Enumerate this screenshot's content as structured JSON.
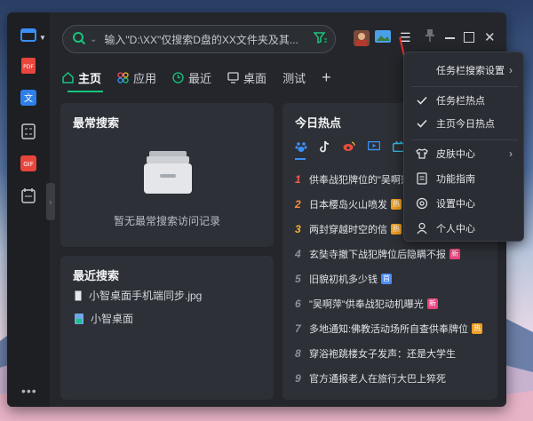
{
  "search": {
    "placeholder": "输入\"D:\\XX\"仅搜索D盘的XX文件夹及其..."
  },
  "tabs": [
    {
      "label": "主页"
    },
    {
      "label": "应用"
    },
    {
      "label": "最近"
    },
    {
      "label": "桌面"
    },
    {
      "label": "测试"
    },
    {
      "label": "+"
    }
  ],
  "frequent": {
    "title": "最常搜索",
    "empty": "暂无最常搜索访问记录"
  },
  "recent": {
    "title": "最近搜索",
    "items": [
      {
        "name": "小智桌面手机端同步.jpg"
      },
      {
        "name": "小智桌面"
      }
    ]
  },
  "hot": {
    "title": "今日热点",
    "items": [
      {
        "rank": "1",
        "text": "供奉战犯牌位的\"吴啊萍",
        "badge": ""
      },
      {
        "rank": "2",
        "text": "日本樱岛火山喷发",
        "badge": "热"
      },
      {
        "rank": "3",
        "text": "两封穿越时空的信",
        "badge": "热"
      },
      {
        "rank": "4",
        "text": "玄奘寺撤下战犯牌位后隐瞒不报",
        "badge": "新"
      },
      {
        "rank": "5",
        "text": "旧貌初机多少钱",
        "badge": "首"
      },
      {
        "rank": "6",
        "text": "\"吴啊萍\"供奉战犯动机曝光",
        "badge": "新"
      },
      {
        "rank": "7",
        "text": "多地通知:佛教活动场所自查供奉牌位",
        "badge": "热"
      },
      {
        "rank": "8",
        "text": "穿浴袍跳楼女子发声：还是大学生",
        "badge": ""
      },
      {
        "rank": "9",
        "text": "官方通报老人在旅行大巴上猝死",
        "badge": ""
      }
    ]
  },
  "menu": {
    "items": [
      {
        "label": "任务栏搜索设置",
        "icon": "none",
        "submenu": true
      },
      {
        "label": "任务栏热点",
        "icon": "check-icon",
        "submenu": false
      },
      {
        "label": "主页今日热点",
        "icon": "check-icon",
        "submenu": false
      },
      {
        "label": "皮肤中心",
        "icon": "shirt-icon",
        "submenu": true
      },
      {
        "label": "功能指南",
        "icon": "guide-icon",
        "submenu": false
      },
      {
        "label": "设置中心",
        "icon": "settings-icon",
        "submenu": false
      },
      {
        "label": "个人中心",
        "icon": "user-icon",
        "submenu": false
      }
    ]
  },
  "colors": {
    "accent": "#19c37d",
    "rank1": "#ff5a4e",
    "rank2": "#ff8a3d",
    "rank3": "#f5b431",
    "menu_bg": "#2a2d33",
    "window_bg": "#24262b"
  }
}
